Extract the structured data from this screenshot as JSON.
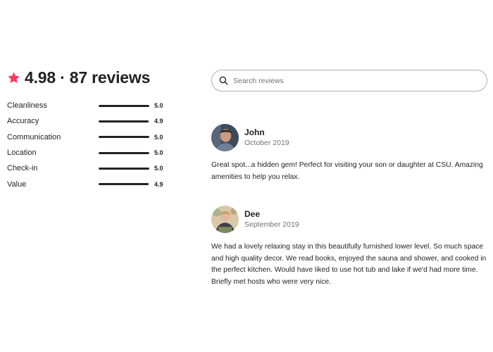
{
  "summary": {
    "title": "4.98 · 87 reviews",
    "star_icon": "star-icon",
    "star_color": "#FF385C"
  },
  "ratings": [
    {
      "label": "Cleanliness",
      "value": "5.0",
      "fill": 1.0
    },
    {
      "label": "Accuracy",
      "value": "4.9",
      "fill": 0.98
    },
    {
      "label": "Communication",
      "value": "5.0",
      "fill": 1.0
    },
    {
      "label": "Location",
      "value": "5.0",
      "fill": 1.0
    },
    {
      "label": "Check-in",
      "value": "5.0",
      "fill": 1.0
    },
    {
      "label": "Value",
      "value": "4.9",
      "fill": 0.98
    }
  ],
  "search": {
    "placeholder": "Search reviews",
    "icon": "search-icon"
  },
  "reviews": [
    {
      "name": "John",
      "date": "October 2019",
      "text": "Great spot...a hidden gem! Perfect for visiting your son or daughter at CSU. Amazing amenities to help you relax."
    },
    {
      "name": "Dee",
      "date": "September 2019",
      "text": "We had a lovely relaxing stay in this beautifully furnished lower level. So much space and high quality decor. We read books, enjoyed the sauna and shower, and cooked in the perfect kitchen. Would have liked to use hot tub and lake if we'd had more time. Briefly met hosts who were very nice."
    }
  ],
  "colors": {
    "text": "#222222",
    "muted": "#717171",
    "border": "#B0B0B0",
    "accent": "#FF385C"
  }
}
